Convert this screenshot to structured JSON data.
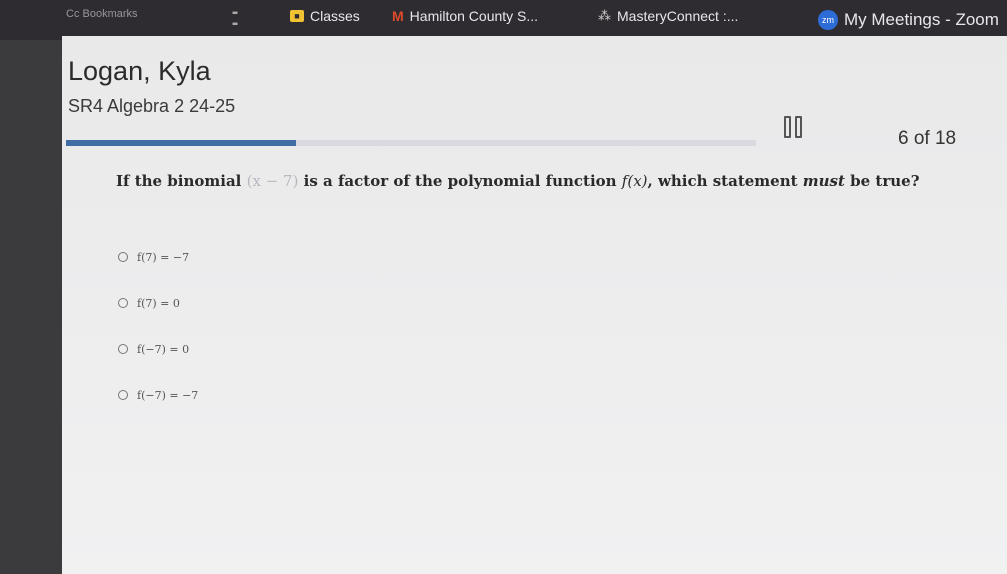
{
  "bookmarks_bar": {
    "items": [
      {
        "label": "Cc Bookmarks",
        "icon": "apps-icon"
      },
      {
        "label": "Classes",
        "icon": "classes-icon"
      },
      {
        "label": "Hamilton County S...",
        "icon": "hamilton-county-icon"
      },
      {
        "label": "MasteryConnect :...",
        "icon": "masteryconnect-icon"
      },
      {
        "label": "My Meetings - Zoom",
        "icon": "zoom-icon",
        "icon_text": "zm"
      }
    ]
  },
  "student": {
    "name": "Logan, Kyla",
    "course": "SR4 Algebra 2 24-25"
  },
  "progress": {
    "text": "6 of 18",
    "current": 6,
    "total": 18
  },
  "question": {
    "prefix": "If the binomial",
    "binomial": "(x − 7)",
    "middle": " is a factor of the polynomial function ",
    "func": "f(x)",
    "suffix1": ", which statement ",
    "emphasis": "must",
    "suffix2": " be true?"
  },
  "choices": [
    {
      "label": "f(7) = −7"
    },
    {
      "label": "f(7) = 0"
    },
    {
      "label": "f(−7) = 0"
    },
    {
      "label": "f(−7) = −7"
    }
  ],
  "colors": {
    "accent": "#3e6da6",
    "bookmarks_bg": "#2e2c30",
    "page_bg": "#ececed"
  }
}
